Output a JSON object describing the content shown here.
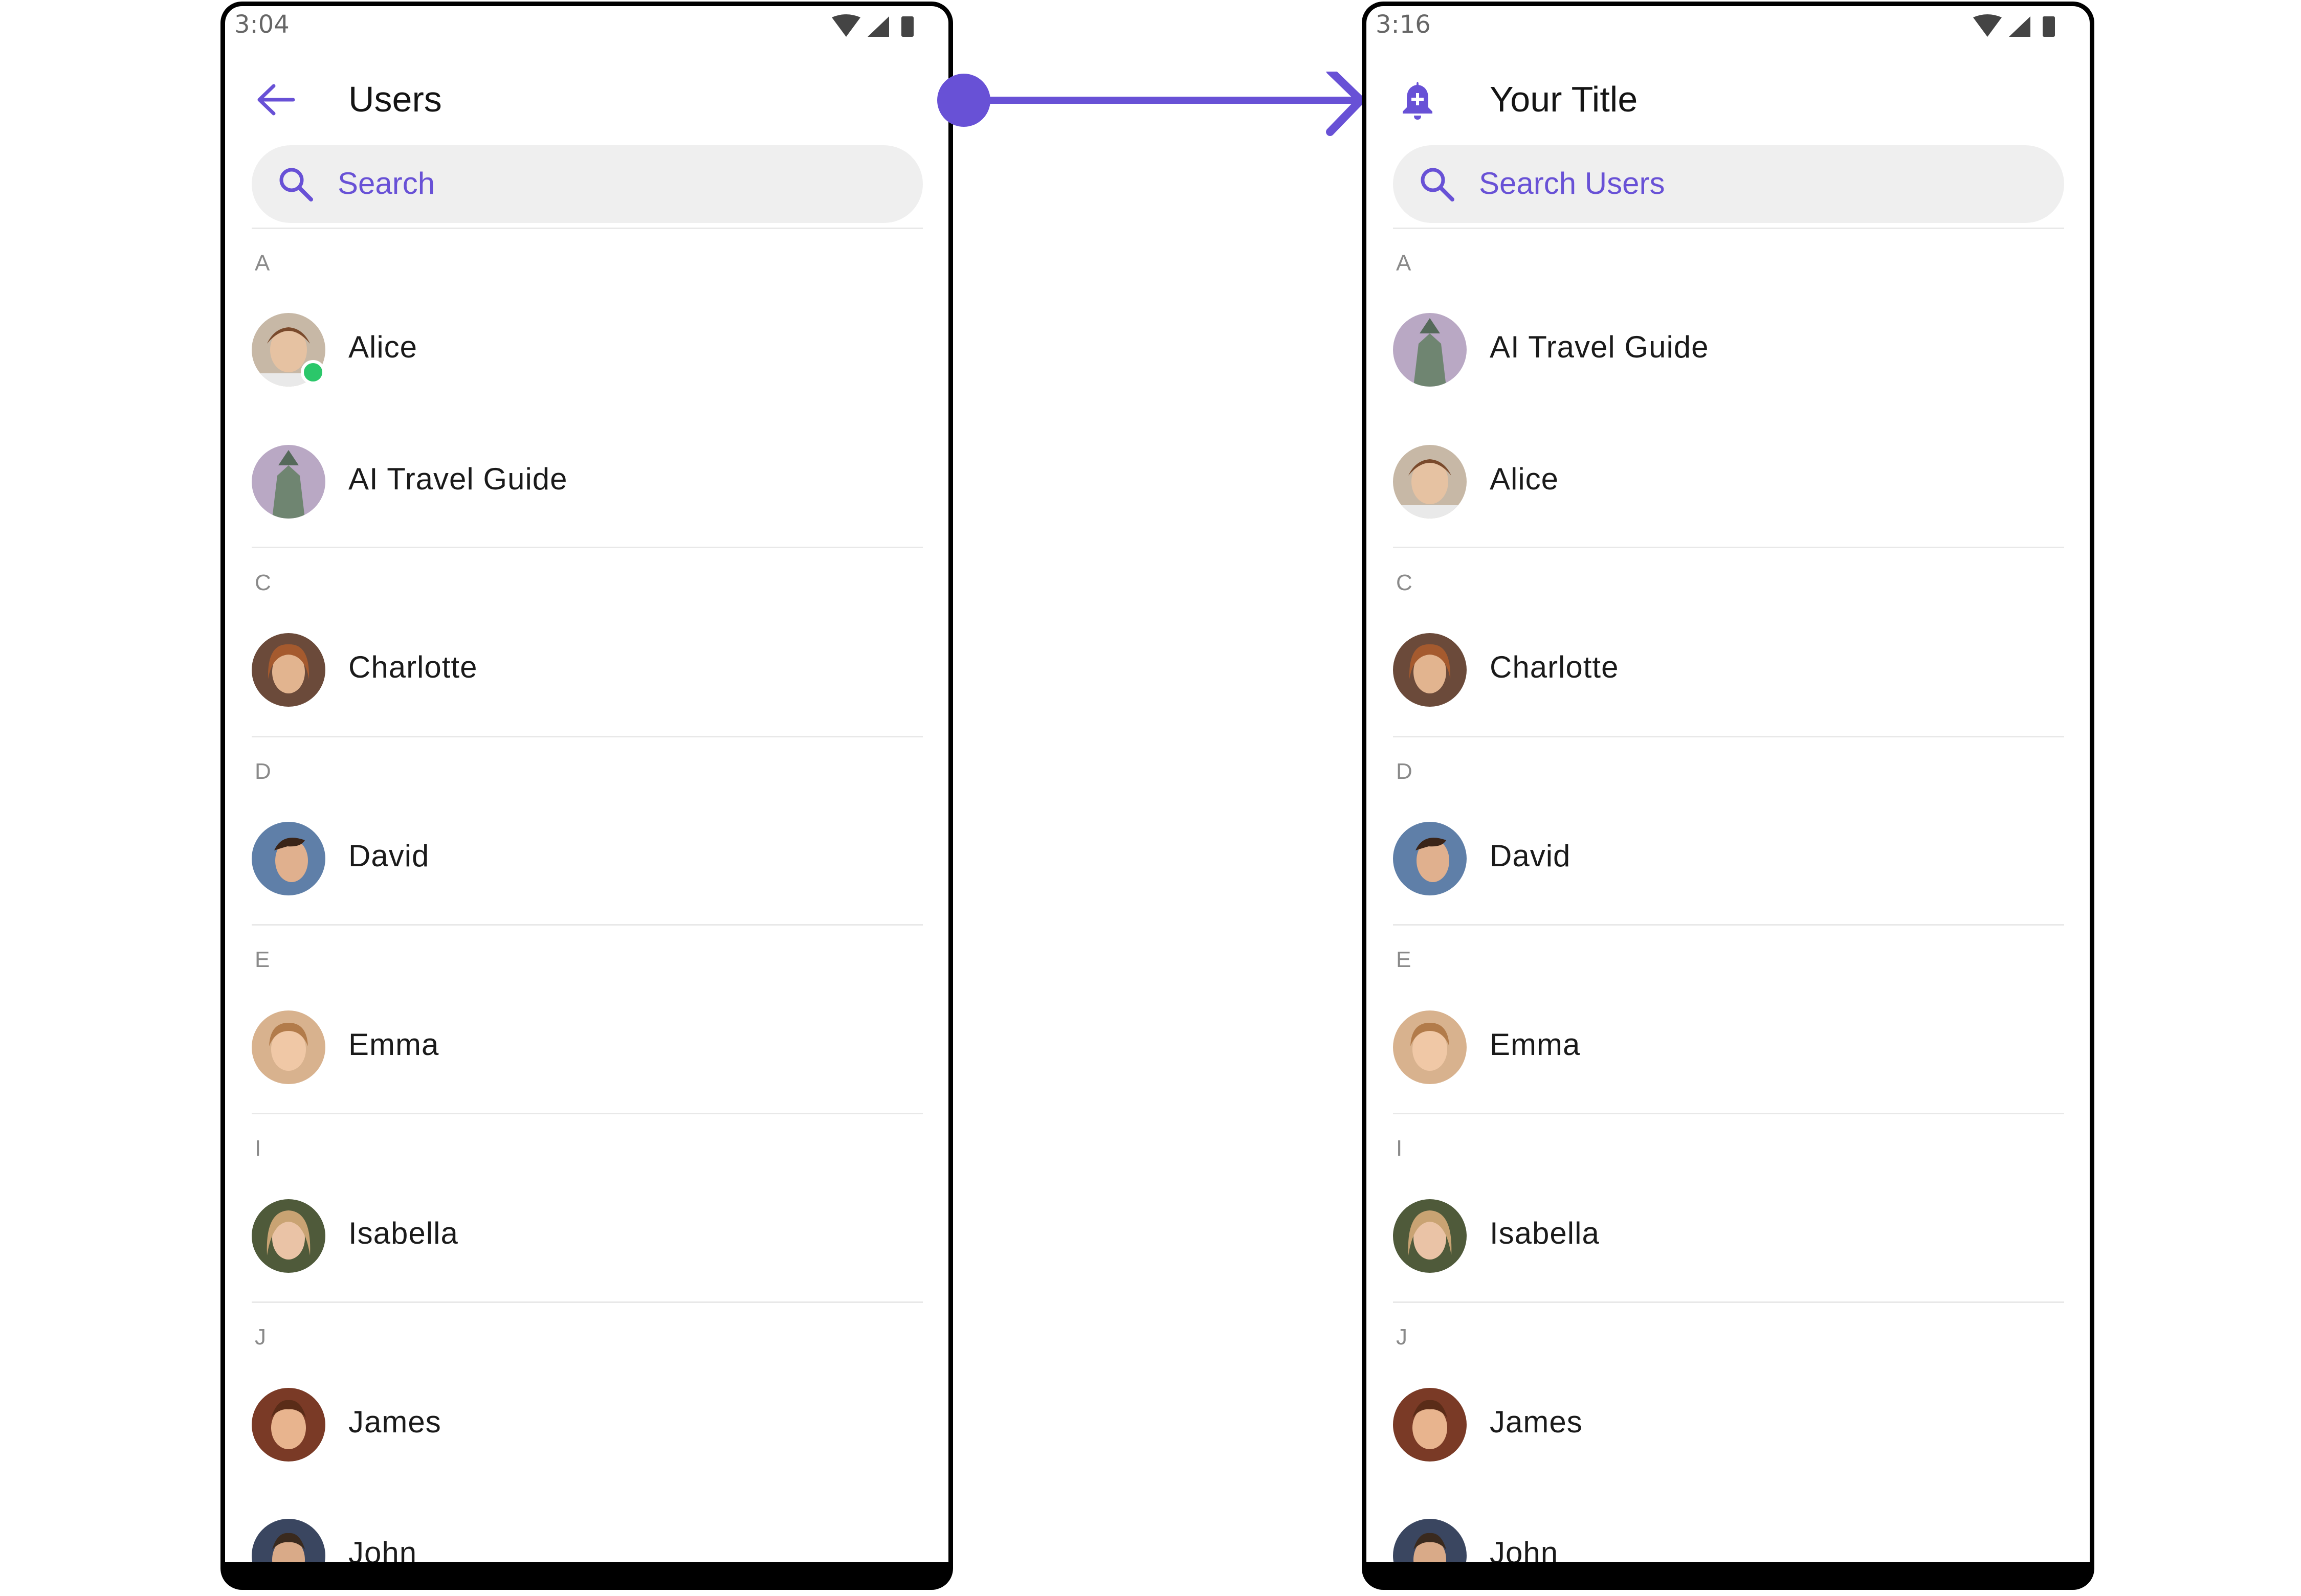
{
  "colors": {
    "accent": "#6851d6",
    "online": "#2bc76a",
    "divider": "#e8e8e8"
  },
  "before": {
    "status_time": "3:04",
    "back_icon": "arrow-left-icon",
    "title": "Users",
    "search_placeholder": "Search",
    "sections": [
      {
        "letter": "A",
        "users": [
          {
            "name": "Alice",
            "online": true
          },
          {
            "name": "AI Travel Guide",
            "online": false
          }
        ]
      },
      {
        "letter": "C",
        "users": [
          {
            "name": "Charlotte"
          }
        ]
      },
      {
        "letter": "D",
        "users": [
          {
            "name": "David"
          }
        ]
      },
      {
        "letter": "E",
        "users": [
          {
            "name": "Emma"
          }
        ]
      },
      {
        "letter": "I",
        "users": [
          {
            "name": "Isabella"
          }
        ]
      },
      {
        "letter": "J",
        "users": [
          {
            "name": "James"
          },
          {
            "name": "John"
          }
        ]
      }
    ]
  },
  "after": {
    "status_time": "3:16",
    "title_icon": "bell-plus-icon",
    "title": "Your Title",
    "search_placeholder": "Search Users",
    "sections": [
      {
        "letter": "A",
        "users": [
          {
            "name": "AI Travel Guide"
          },
          {
            "name": "Alice"
          }
        ]
      },
      {
        "letter": "C",
        "users": [
          {
            "name": "Charlotte"
          }
        ]
      },
      {
        "letter": "D",
        "users": [
          {
            "name": "David"
          }
        ]
      },
      {
        "letter": "E",
        "users": [
          {
            "name": "Emma"
          }
        ]
      },
      {
        "letter": "I",
        "users": [
          {
            "name": "Isabella"
          }
        ]
      },
      {
        "letter": "J",
        "users": [
          {
            "name": "James"
          },
          {
            "name": "John"
          }
        ]
      }
    ]
  }
}
